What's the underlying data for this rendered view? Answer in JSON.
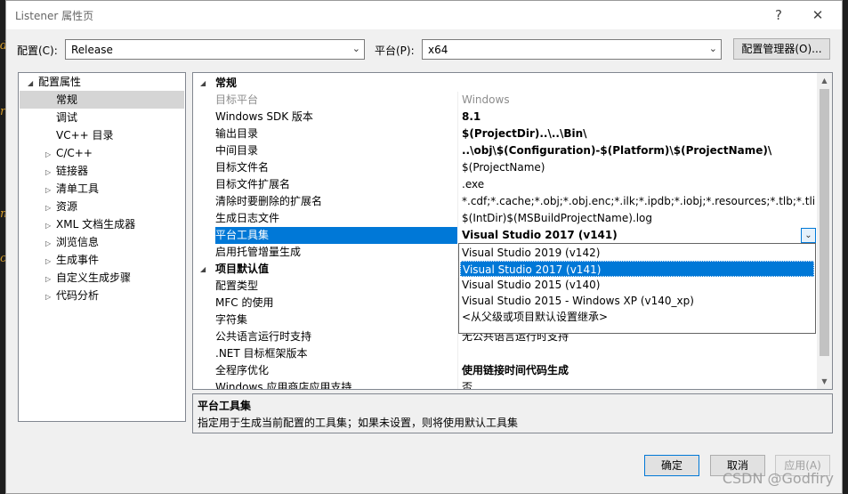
{
  "window": {
    "title": "Listener 属性页",
    "help_label": "?",
    "close_label": "✕"
  },
  "config": {
    "config_label": "配置(C):",
    "config_value": "Release",
    "platform_label": "平台(P):",
    "platform_value": "x64",
    "manager_label": "配置管理器(O)..."
  },
  "tree": {
    "root": "配置属性",
    "items": [
      "常规",
      "调试",
      "VC++ 目录",
      "C/C++",
      "链接器",
      "清单工具",
      "资源",
      "XML 文档生成器",
      "浏览信息",
      "生成事件",
      "自定义生成步骤",
      "代码分析"
    ]
  },
  "grid": {
    "cat_general": "常规",
    "rows_general": [
      {
        "name": "目标平台",
        "value": "Windows"
      },
      {
        "name": "Windows SDK 版本",
        "value": "8.1"
      },
      {
        "name": "输出目录",
        "value": "$(ProjectDir)..\\..\\Bin\\"
      },
      {
        "name": "中间目录",
        "value": "..\\obj\\$(Configuration)-$(Platform)\\$(ProjectName)\\"
      },
      {
        "name": "目标文件名",
        "value": "$(ProjectName)"
      },
      {
        "name": "目标文件扩展名",
        "value": ".exe"
      },
      {
        "name": "清除时要删除的扩展名",
        "value": "*.cdf;*.cache;*.obj;*.obj.enc;*.ilk;*.ipdb;*.iobj;*.resources;*.tlb;*.tli;*.tlh;*.tmp;*.rsp;*.pgc;*.pgd;*.meta;*.tlog;*.manifest;*.res;*.pch;*.exp;*.idb;*.rep;*.xdc;*.pdb;*_manifest.rc;*.bsc;*.sbr;*.xml;*.metagen;*.bi"
      },
      {
        "name": "生成日志文件",
        "value": "$(IntDir)$(MSBuildProjectName).log"
      },
      {
        "name": "平台工具集",
        "value": "Visual Studio 2017 (v141)"
      },
      {
        "name": "启用托管增量生成",
        "value": ""
      }
    ],
    "cat_defaults": "项目默认值",
    "rows_defaults": [
      {
        "name": "配置类型",
        "value": ""
      },
      {
        "name": "MFC 的使用",
        "value": ""
      },
      {
        "name": "字符集",
        "value": ""
      },
      {
        "name": "公共语言运行时支持",
        "value": "无公共语言运行时支持"
      },
      {
        "name": ".NET 目标框架版本",
        "value": ""
      },
      {
        "name": "全程序优化",
        "value": "使用链接时间代码生成"
      },
      {
        "name": "Windows 应用商店应用支持",
        "value": "否"
      }
    ]
  },
  "dropdown": {
    "options": [
      "Visual Studio 2019 (v142)",
      "Visual Studio 2017 (v141)",
      "Visual Studio 2015 (v140)",
      "Visual Studio 2015 - Windows XP (v140_xp)",
      "<从父级或项目默认设置继承>"
    ],
    "selected": "Visual Studio 2017 (v141)"
  },
  "description": {
    "title": "平台工具集",
    "text": "指定用于生成当前配置的工具集；如果未设置，则将使用默认工具集"
  },
  "buttons": {
    "ok": "确定",
    "cancel": "取消",
    "apply": "应用(A)"
  },
  "watermark": "CSDN @Godfiry",
  "background_code": [
    "d",
    "r",
    "m",
    "c"
  ]
}
